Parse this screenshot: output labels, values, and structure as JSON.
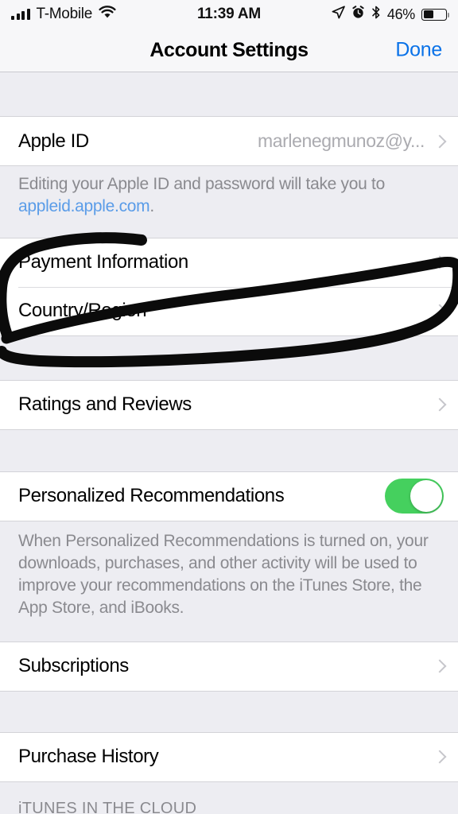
{
  "status_bar": {
    "signal_icon": "cellular-bars-icon",
    "carrier": "T-Mobile",
    "wifi_icon": "wifi-icon",
    "time": "11:39 AM",
    "location_icon": "location-arrow-icon",
    "alarm_icon": "alarm-clock-icon",
    "bluetooth_icon": "bluetooth-icon",
    "battery_percent": "46%",
    "battery_icon": "battery-icon",
    "battery_level": 46
  },
  "nav": {
    "title": "Account Settings",
    "done_label": "Done",
    "done_color": "#0A72E8"
  },
  "sections": {
    "apple_id": {
      "row_label": "Apple ID",
      "row_value": "marlenegmunoz@y...",
      "footnote_prefix": "Editing your Apple ID and password will take you to ",
      "footnote_link": "appleid.apple.com",
      "footnote_suffix": "."
    },
    "payment": {
      "payment_label": "Payment Information",
      "country_label": "Country/Region"
    },
    "ratings": {
      "label": "Ratings and Reviews"
    },
    "personalized": {
      "label": "Personalized Recommendations",
      "toggle_state": "on",
      "toggle_color": "#45D05E",
      "footnote": "When Personalized Recommendations is turned on, your downloads, purchases, and other activity will be used to improve your recommendations on the iTunes Store, the App Store, and iBooks."
    },
    "subscriptions": {
      "label": "Subscriptions"
    },
    "purchase_history": {
      "label": "Purchase History"
    },
    "itunes_cloud": {
      "header": "iTUNES IN THE CLOUD"
    }
  },
  "annotation": {
    "type": "hand-drawn-ink-loop",
    "color": "#0B0B0B",
    "targets": "Payment Information, Country/Region"
  }
}
